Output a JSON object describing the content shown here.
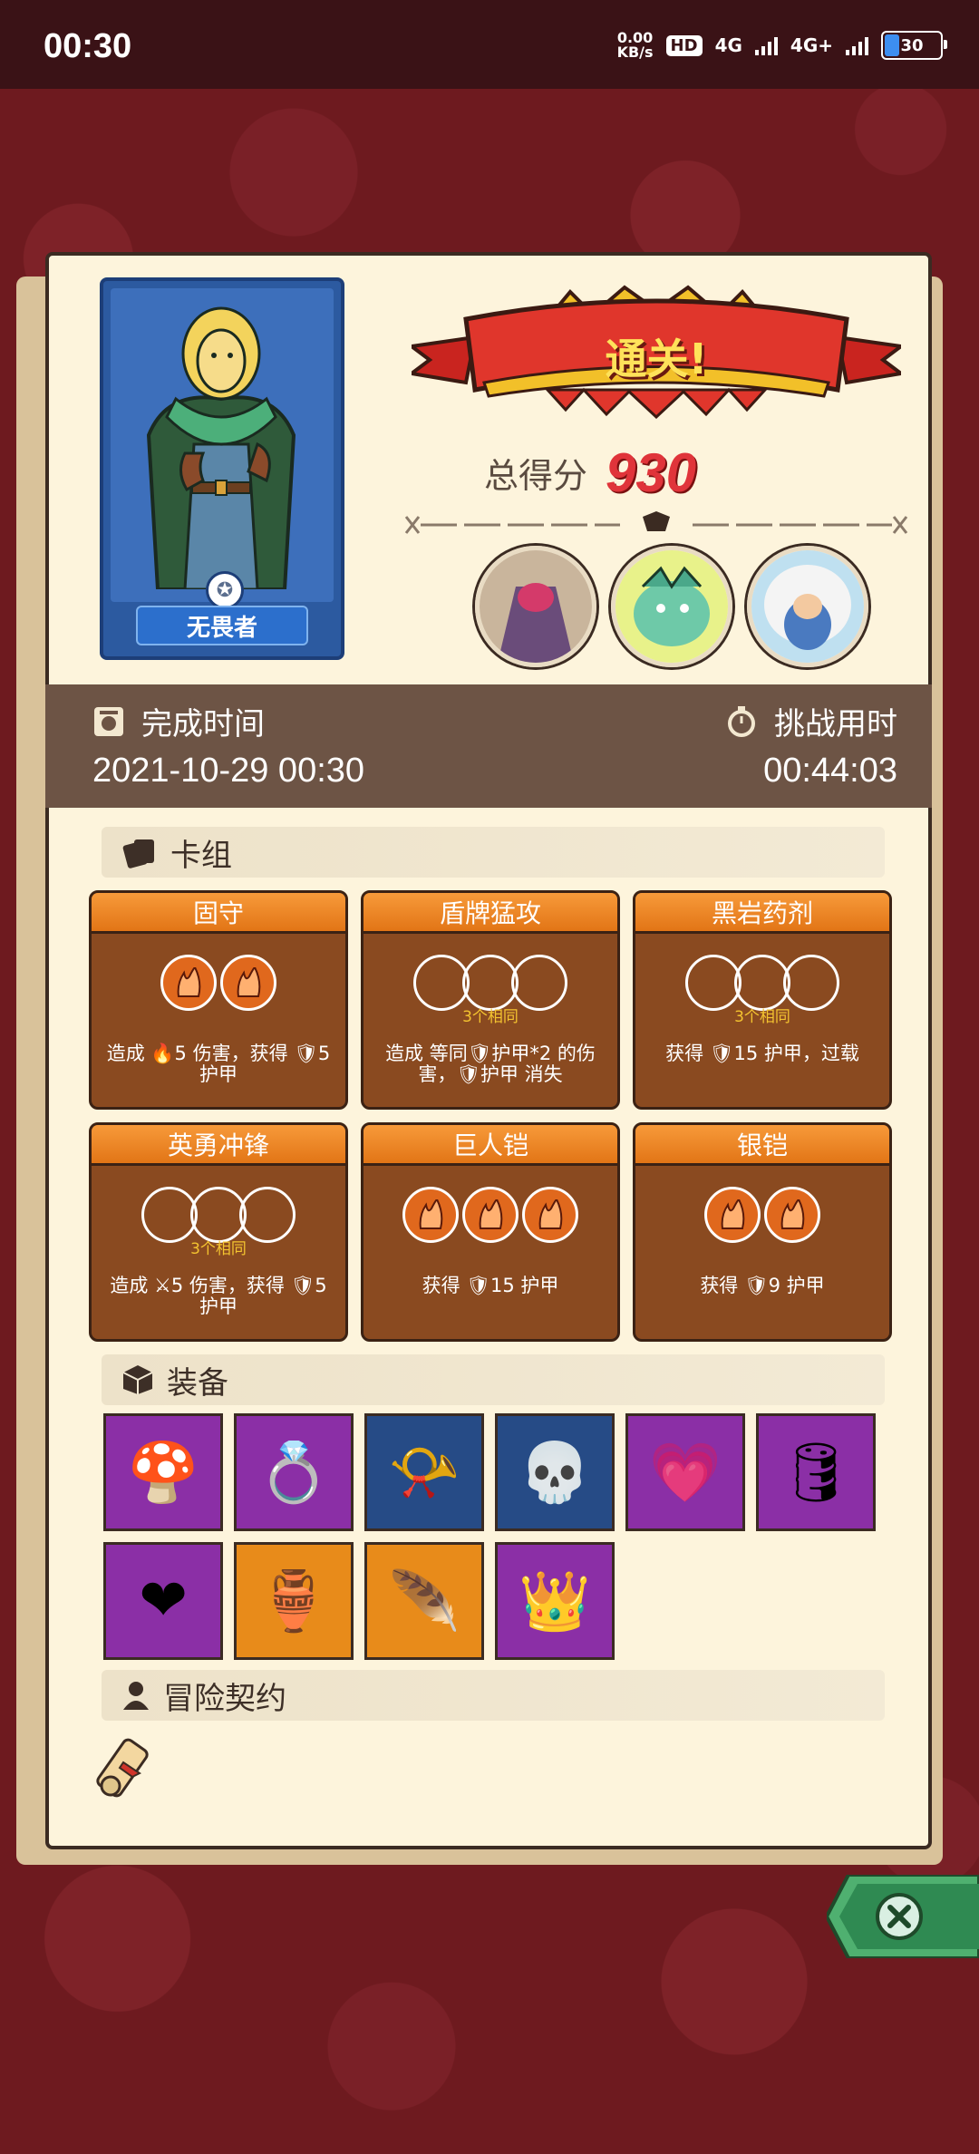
{
  "status_bar": {
    "time": "00:30",
    "speed_top": "0.00",
    "speed_unit": "KB/s",
    "hd": "HD",
    "net1": "4G",
    "net2": "4G+",
    "battery": "30"
  },
  "result": {
    "banner": "通关!",
    "score_label": "总得分",
    "score_value": "930"
  },
  "hero": {
    "name": "无畏者"
  },
  "completion": {
    "finish_label": "完成时间",
    "finish_value": "2021-10-29 00:30",
    "duration_label": "挑战用时",
    "duration_value": "00:44:03"
  },
  "sections": {
    "deck": "卡组",
    "equipment": "装备",
    "contract": "冒险契约"
  },
  "cards": [
    {
      "title": "固守",
      "dice": 2,
      "match": "",
      "desc": "造成 🔥5 伤害，获得 🛡5 护甲"
    },
    {
      "title": "盾牌猛攻",
      "dice": 3,
      "empty": true,
      "match": "3个相同",
      "desc": "造成 等同🛡护甲*2 的伤害，🛡护甲 消失"
    },
    {
      "title": "黑岩药剂",
      "dice": 3,
      "empty": true,
      "match": "3个相同",
      "desc": "获得 🛡15 护甲，过载"
    },
    {
      "title": "英勇冲锋",
      "dice": 3,
      "empty": true,
      "match": "3个相同",
      "desc": "造成 ⚔5 伤害，获得 🛡5 护甲"
    },
    {
      "title": "巨人铠",
      "dice": 3,
      "match": "",
      "desc": "获得 🛡15 护甲"
    },
    {
      "title": "银铠",
      "dice": 2,
      "match": "",
      "desc": "获得 🛡9 护甲"
    }
  ],
  "equipment": [
    {
      "icon": "mushroom-icon",
      "rarity": "purple"
    },
    {
      "icon": "ring-icon",
      "rarity": "purple"
    },
    {
      "icon": "bone-horn-icon",
      "rarity": "blue"
    },
    {
      "icon": "skull-helmet-icon",
      "rarity": "blue"
    },
    {
      "icon": "heart-amulet-icon",
      "rarity": "purple"
    },
    {
      "icon": "gem-bracer-icon",
      "rarity": "purple"
    },
    {
      "icon": "heart-card-icon",
      "rarity": "purple"
    },
    {
      "icon": "vase-icon",
      "rarity": "orange"
    },
    {
      "icon": "flame-feather-icon",
      "rarity": "orange"
    },
    {
      "icon": "crown-icon",
      "rarity": "purple"
    }
  ],
  "colors": {
    "background": "#6e1a1f",
    "paper": "#fdf4dc",
    "score": "#e0343a",
    "card": "#8a4a20",
    "card_title": "#e27516"
  }
}
